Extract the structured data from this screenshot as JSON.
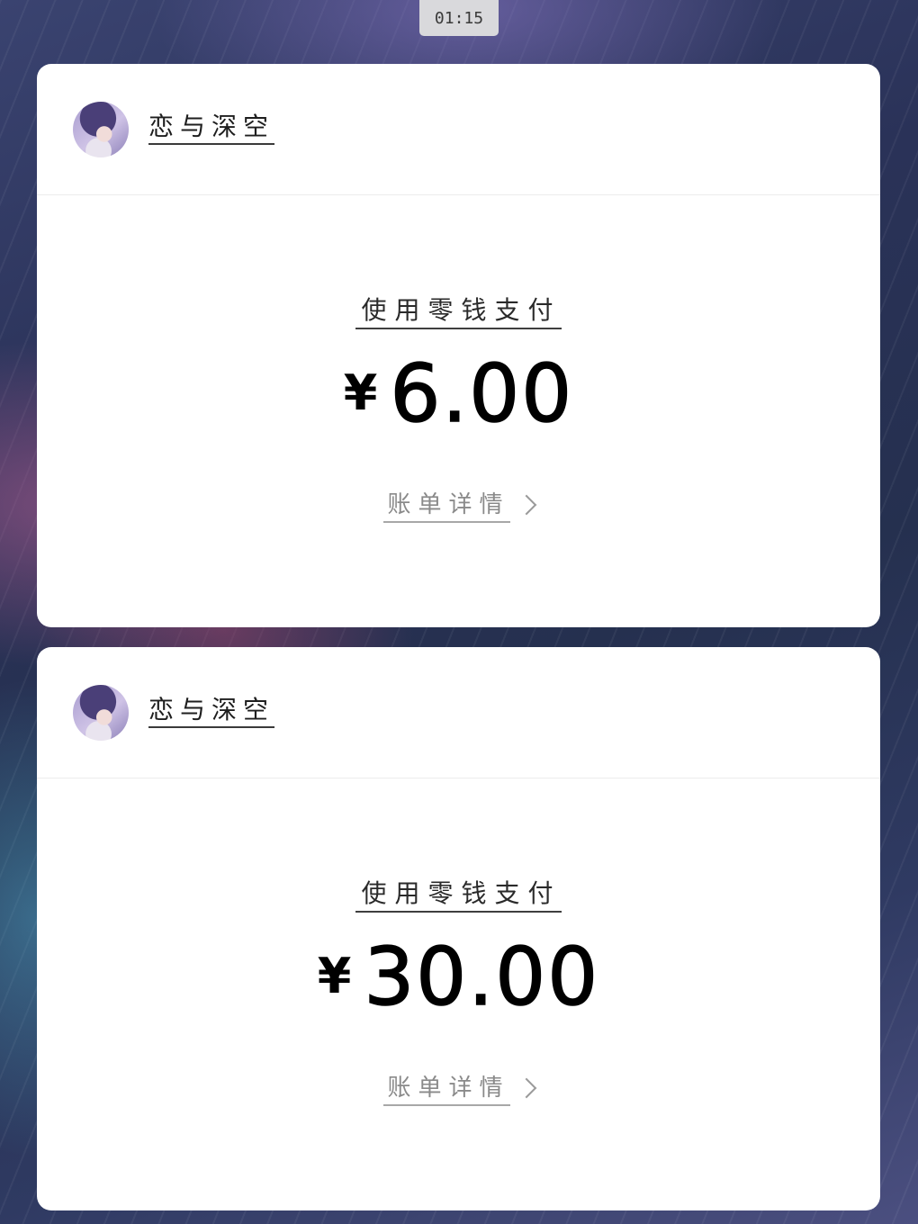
{
  "status": {
    "time": "01:15"
  },
  "colors": {
    "card_background": "#ffffff",
    "amount_text": "#000000",
    "link_text": "#8a8a8a"
  },
  "payments": [
    {
      "app_name": "恋与深空",
      "avatar_icon": "avatar-portrait-icon",
      "pay_method": "使用零钱支付",
      "currency": "¥",
      "amount": "6.00",
      "bill_detail_label": "账单详情",
      "bill_detail_icon": "chevron-right-icon"
    },
    {
      "app_name": "恋与深空",
      "avatar_icon": "avatar-portrait-icon",
      "pay_method": "使用零钱支付",
      "currency": "¥",
      "amount": "30.00",
      "bill_detail_label": "账单详情",
      "bill_detail_icon": "chevron-right-icon"
    }
  ]
}
